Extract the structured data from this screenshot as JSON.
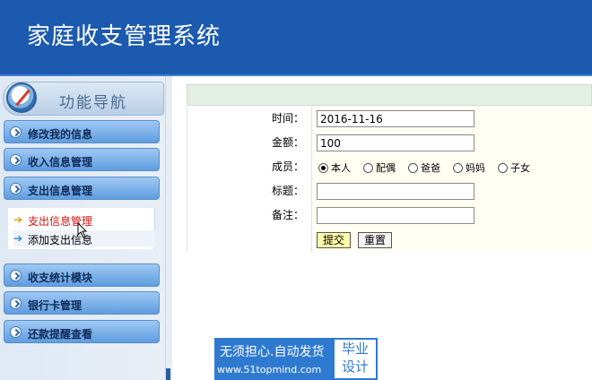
{
  "header": {
    "title": "家庭收支管理系统"
  },
  "sidebar": {
    "nav_title": "功能导航",
    "menus": [
      {
        "label": "修改我的信息"
      },
      {
        "label": "收入信息管理"
      },
      {
        "label": "支出信息管理"
      },
      {
        "label": "收支统计模块"
      },
      {
        "label": "银行卡管理"
      },
      {
        "label": "还款提醒查看"
      }
    ],
    "submenu": [
      {
        "label": "支出信息管理",
        "arrow": "➔"
      },
      {
        "label": "添加支出信息",
        "arrow": "➔"
      }
    ]
  },
  "form": {
    "time": {
      "label": "时间：",
      "value": "2016-11-16"
    },
    "amount": {
      "label": "金额：",
      "value": "100"
    },
    "member": {
      "label": "成员：",
      "options": [
        "本人",
        "配偶",
        "爸爸",
        "妈妈",
        "子女"
      ],
      "selected": "本人"
    },
    "title_field": {
      "label": "标题：",
      "value": ""
    },
    "note_field": {
      "label": "备注：",
      "value": ""
    },
    "submit_label": "提交",
    "reset_label": "重置"
  },
  "watermark": {
    "line1": "无须担心.自动发货",
    "line2": "www.51topmind.com",
    "box_line1": "毕业",
    "box_line2": "设计"
  },
  "colors": {
    "header_bg": "#1c5ab0",
    "menu_blue": "#5f9de0",
    "active_red": "#d41111"
  }
}
